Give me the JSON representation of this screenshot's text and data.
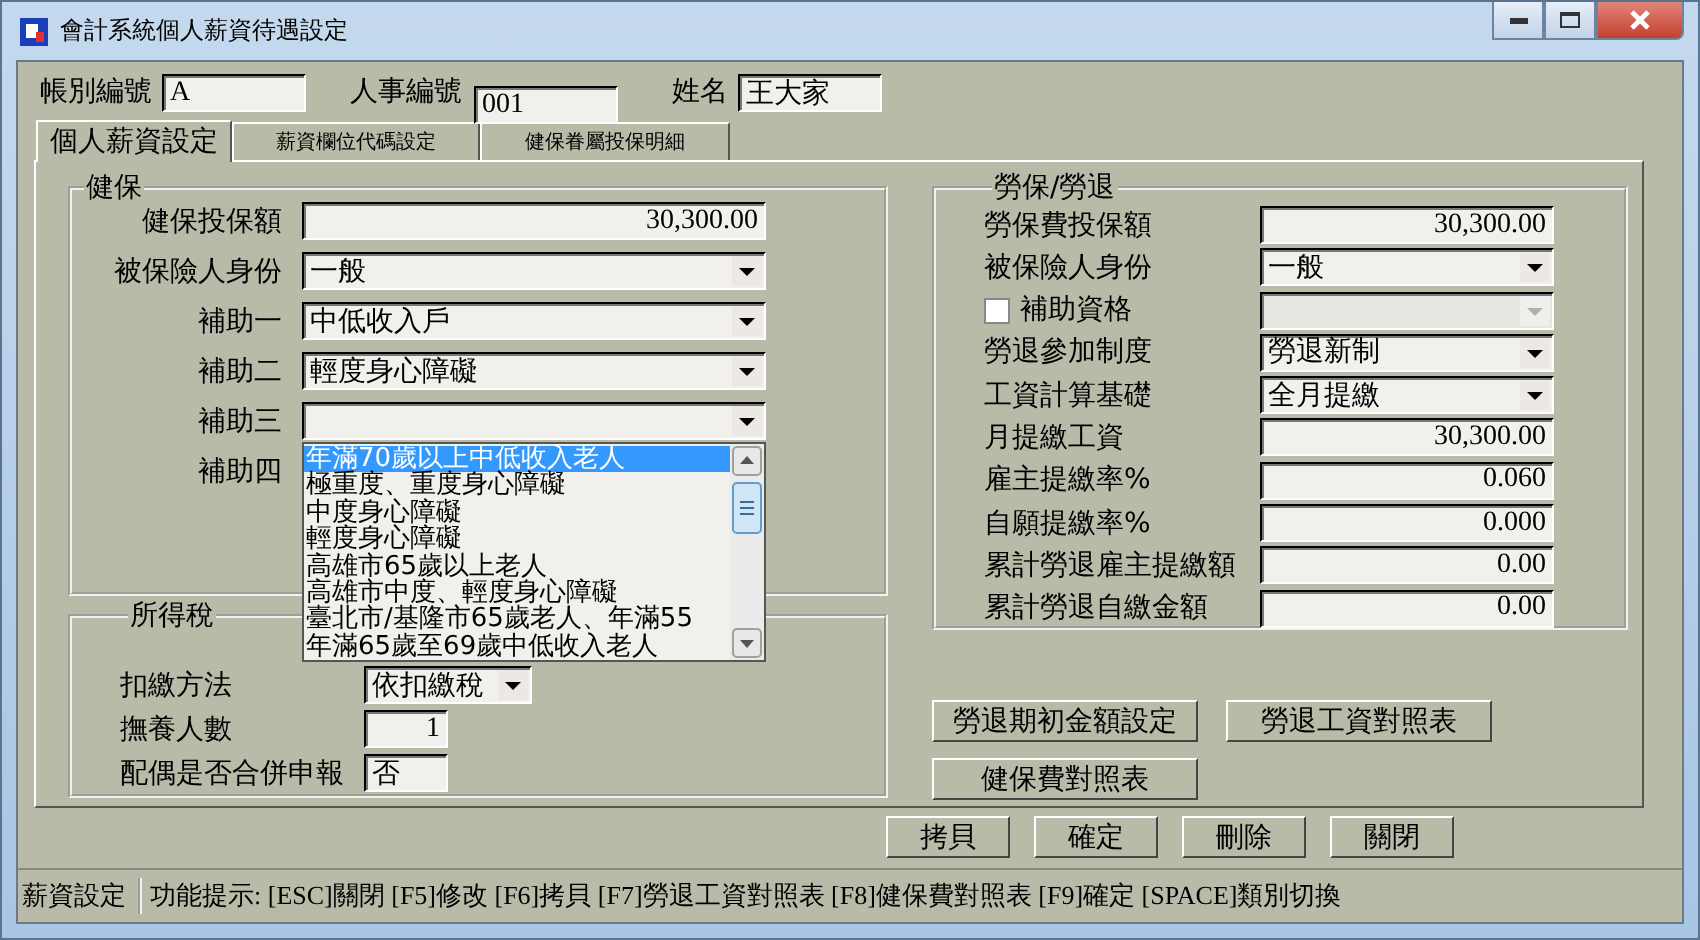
{
  "window": {
    "title": "會計系統個人薪資待遇設定"
  },
  "header_fields": [
    {
      "label": "帳別編號",
      "value": "A"
    },
    {
      "label": "人事編號",
      "value": "001"
    },
    {
      "label": "姓名",
      "value": "王大家"
    }
  ],
  "tabs": [
    {
      "label": "個人薪資設定",
      "selected": true
    },
    {
      "label": "薪資欄位代碼設定",
      "selected": false
    },
    {
      "label": "健保眷屬投保明細",
      "selected": false
    }
  ],
  "health_insurance": {
    "title": "健保",
    "rows": [
      {
        "kind": "number",
        "label": "健保投保額",
        "value": "30,300.00"
      },
      {
        "kind": "select",
        "label": "被保險人身份",
        "value": "一般"
      },
      {
        "kind": "select",
        "label": "補助一",
        "value": "中低收入戶"
      },
      {
        "kind": "select",
        "label": "補助二",
        "value": "輕度身心障礙"
      },
      {
        "kind": "open-select",
        "label": "補助三"
      },
      {
        "kind": "covered",
        "label": "補助四"
      }
    ]
  },
  "dropdown_list": {
    "options": [
      {
        "label": "年滿70歲以上中低收入老人",
        "selected": true
      },
      {
        "label": "極重度、重度身心障礙",
        "selected": false
      },
      {
        "label": "中度身心障礙",
        "selected": false
      },
      {
        "label": "輕度身心障礙",
        "selected": false
      },
      {
        "label": "高雄市65歲以上老人",
        "selected": false
      },
      {
        "label": "高雄市中度、輕度身心障礙",
        "selected": false
      },
      {
        "label": "臺北市/基隆市65歲老人、年滿55",
        "selected": false
      },
      {
        "label": "年滿65歲至69歲中低收入老人",
        "selected": false
      }
    ]
  },
  "income_tax": {
    "title": "所得稅",
    "rows": [
      {
        "kind": "select",
        "label": "扣繳方法",
        "value": "依扣繳稅"
      },
      {
        "kind": "number",
        "label": "撫養人數",
        "value": "1"
      },
      {
        "kind": "text",
        "label": "配偶是否合併申報",
        "value": "否"
      }
    ]
  },
  "labor": {
    "title": "勞保/勞退",
    "rows": [
      {
        "kind": "number",
        "label": "勞保費投保額",
        "value": "30,300.00"
      },
      {
        "kind": "select",
        "label": "被保險人身份",
        "value": "一般"
      },
      {
        "kind": "check-select",
        "label": "補助資格",
        "checked": false,
        "disabled": true
      },
      {
        "kind": "select",
        "label": "勞退參加制度",
        "value": "勞退新制"
      },
      {
        "kind": "select",
        "label": "工資計算基礎",
        "value": "全月提繳"
      },
      {
        "kind": "number",
        "label": "月提繳工資",
        "value": "30,300.00"
      },
      {
        "kind": "number",
        "label": "雇主提繳率%",
        "value": "0.060"
      },
      {
        "kind": "number",
        "label": "自願提繳率%",
        "value": "0.000"
      },
      {
        "kind": "number",
        "label": "累計勞退雇主提繳額",
        "value": "0.00"
      },
      {
        "kind": "number",
        "label": "累計勞退自繳金額",
        "value": "0.00"
      }
    ]
  },
  "labor_buttons": [
    "勞退期初金額設定",
    "勞退工資對照表",
    "健保費對照表"
  ],
  "buttons": [
    "拷貝",
    "確定",
    "刪除",
    "關閉"
  ],
  "status_bar": {
    "mode": "薪資設定",
    "hint": "功能提示: [ESC]關閉 [F5]修改 [F6]拷貝 [F7]勞退工資對照表 [F8]健保費對照表 [F9]確定 [SPACE]類別切換"
  }
}
